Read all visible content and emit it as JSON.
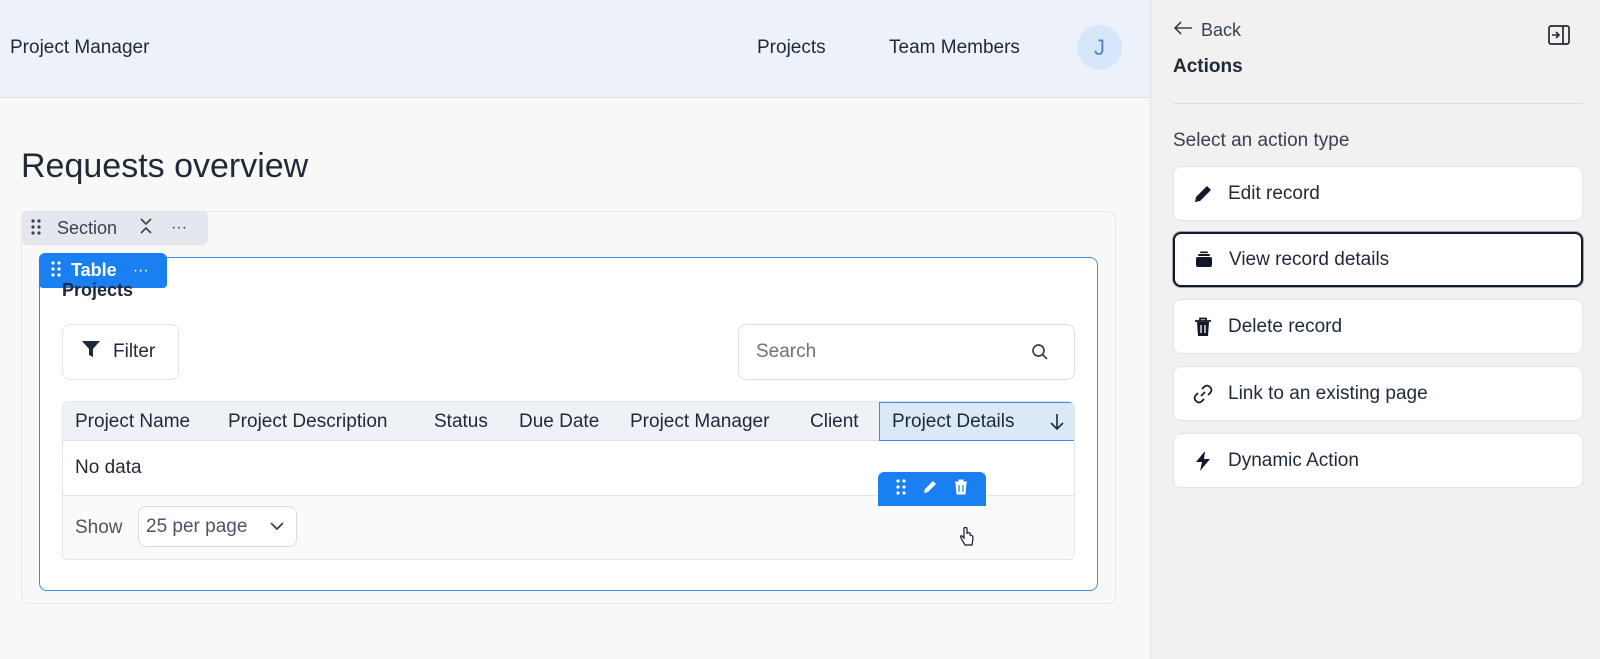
{
  "navbar": {
    "app_title": "Project Manager",
    "links": [
      "Projects",
      "Team Members"
    ],
    "avatar_initial": "J"
  },
  "main": {
    "page_title": "Requests overview",
    "section_tab_label": "Section",
    "table_tab_label": "Table",
    "table_heading": "Projects",
    "filter_label": "Filter",
    "search_placeholder": "Search",
    "columns": [
      "Project Name",
      "Project Description",
      "Status",
      "Due Date",
      "Project Manager",
      "Client",
      "Project Details"
    ],
    "no_data": "No data",
    "show_label": "Show",
    "per_page": "25 per page"
  },
  "panel": {
    "back_label": "Back",
    "title": "Actions",
    "subtitle": "Select an action type",
    "actions": [
      {
        "label": "Edit record",
        "icon": "pencil-icon"
      },
      {
        "label": "View record details",
        "icon": "card-icon"
      },
      {
        "label": "Delete record",
        "icon": "trash-icon"
      },
      {
        "label": "Link to an existing page",
        "icon": "link-icon"
      },
      {
        "label": "Dynamic Action",
        "icon": "bolt-icon"
      }
    ],
    "selected_action": "View record details"
  },
  "colors": {
    "accent": "#1a7ff0",
    "navbar_bg": "#edf2fa",
    "panel_bg": "#f1f1f1"
  }
}
